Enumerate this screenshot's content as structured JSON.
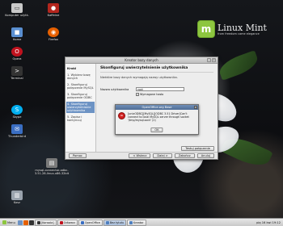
{
  "desktop": {
    "brand": {
      "name": "Linux Mint",
      "tagline": "from freedom came elegance"
    },
    "icons": [
      {
        "name": "komputer-icon",
        "label": "Komputer użytk.",
        "color": "#c9c9c9",
        "glyph": "▭"
      },
      {
        "name": "kaffeine-icon",
        "label": "Kaffeine",
        "color": "#b3261e",
        "glyph": "●"
      },
      {
        "name": "firefox-icon",
        "label": "Firefox",
        "color": "#e66000",
        "glyph": "◉"
      },
      {
        "name": "home-folder-icon",
        "label": "Home",
        "color": "#5a8fd1",
        "glyph": "■"
      },
      {
        "name": "opera-icon",
        "label": "Opera",
        "color": "#c0121e",
        "glyph": "O"
      },
      {
        "name": "terminal-icon",
        "label": "Terminal",
        "color": "#333333",
        "glyph": ">"
      },
      {
        "name": "skype-icon",
        "label": "Skype",
        "color": "#00aff0",
        "glyph": "S"
      },
      {
        "name": "thunderbird-icon",
        "label": "Thunderbird",
        "color": "#3a6ec2",
        "glyph": "✉"
      },
      {
        "name": "connector-icon",
        "label": "mysql-connector-odbc-3.51.28-linux-x86-32bit",
        "color": "#7a7a7a",
        "glyph": "▤"
      },
      {
        "name": "trash-icon",
        "label": "Kosz",
        "color": "#9aa3ad",
        "glyph": "🗑"
      }
    ]
  },
  "wizard": {
    "title": "Kreator bazy danych",
    "steps_title": "Kroki",
    "steps": [
      "1. Wybierz bazę danych",
      "2. Skonfiguruj połączenie MySQL",
      "3. Skonfiguruj połączenie ODBC",
      "4. Skonfiguruj uwierzytelnianie użytkownika",
      "5. Zapisz i kontynuuj"
    ],
    "active_step": 3,
    "heading": "Skonfiguruj uwierzytelnienie użytkownika",
    "description": "Niektóre bazy danych wymagają nazwy użytkownika.",
    "username_label": "Nazwa użytkownika",
    "username_value": "root",
    "password_required_label": "Wymagane hasło",
    "password_required_checked": true,
    "test_button": "Testuj połączenie",
    "help_button": "Pomoc",
    "back_button": "< Wstecz",
    "next_button": "Dalej >",
    "finish_button": "Zakończ",
    "cancel_button": "Anuluj"
  },
  "error_dialog": {
    "title": "OpenOffice.org Base",
    "message": "[unixODBC][MySQL][ODBC 3.51 Driver]Can't connect to local MySQL server through socket '/tmp/mysql.sock' (2)",
    "ok_button": "OK"
  },
  "taskbar": {
    "menu_label": "Menu",
    "items": [
      {
        "label": "[Konsola]",
        "active": false,
        "color": "#333333"
      },
      {
        "label": "Odtwarz",
        "active": false,
        "color": "#c0121e"
      },
      {
        "label": "OpenOffice",
        "active": false,
        "color": "#3a6ec2"
      },
      {
        "label": "Bez tytułu",
        "active": true,
        "color": "#4e7fbf"
      },
      {
        "label": "Kreator",
        "active": false,
        "color": "#4e7fbf"
      }
    ],
    "clock": "pią 16 kwi 19:12"
  }
}
